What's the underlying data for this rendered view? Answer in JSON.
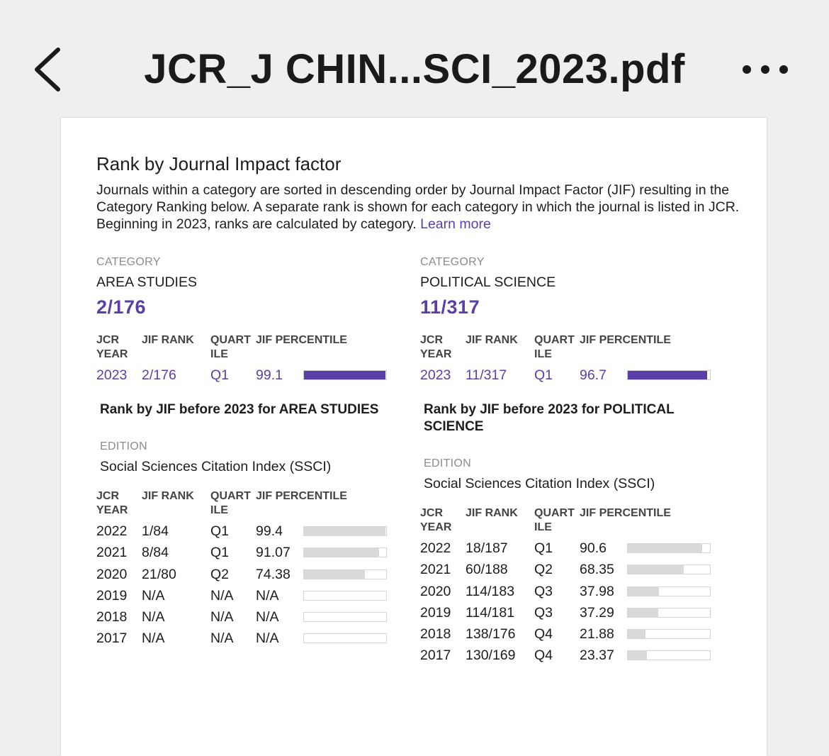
{
  "header": {
    "title": "JCR_J CHIN...SCI_2023.pdf"
  },
  "page": {
    "heading": "Rank by Journal Impact factor",
    "description": "Journals within a category are sorted in descending order by Journal Impact Factor (JIF) resulting in the Category Ranking below. A separate rank is shown for each category in which the journal is listed in JCR. Beginning in 2023, ranks are calculated by category.",
    "learn_more": "Learn more"
  },
  "columns_header": {
    "year": "JCR YEAR",
    "rank": "JIF RANK",
    "quartile": "QUART ILE",
    "percentile": "JIF PERCENTILE"
  },
  "categories": [
    {
      "label": "CATEGORY",
      "name": "AREA STUDIES",
      "rank": "2/176",
      "current": {
        "year": "2023",
        "rank": "2/176",
        "quartile": "Q1",
        "percentile": "99.1",
        "bar": 0.991
      },
      "before_title": "Rank by JIF before 2023 for AREA STUDIES",
      "edition_label": "EDITION",
      "edition": "Social Sciences Citation Index (SSCI)",
      "history": [
        {
          "year": "2022",
          "rank": "1/84",
          "quartile": "Q1",
          "percentile": "99.4",
          "bar": 0.994
        },
        {
          "year": "2021",
          "rank": "8/84",
          "quartile": "Q1",
          "percentile": "91.07",
          "bar": 0.9107
        },
        {
          "year": "2020",
          "rank": "21/80",
          "quartile": "Q2",
          "percentile": "74.38",
          "bar": 0.7438
        },
        {
          "year": "2019",
          "rank": "N/A",
          "quartile": "N/A",
          "percentile": "N/A",
          "bar": 0
        },
        {
          "year": "2018",
          "rank": "N/A",
          "quartile": "N/A",
          "percentile": "N/A",
          "bar": 0
        },
        {
          "year": "2017",
          "rank": "N/A",
          "quartile": "N/A",
          "percentile": "N/A",
          "bar": 0
        }
      ]
    },
    {
      "label": "CATEGORY",
      "name": "POLITICAL SCIENCE",
      "rank": "11/317",
      "current": {
        "year": "2023",
        "rank": "11/317",
        "quartile": "Q1",
        "percentile": "96.7",
        "bar": 0.967
      },
      "before_title": "Rank by JIF before 2023 for POLITICAL SCIENCE",
      "edition_label": "EDITION",
      "edition": "Social Sciences Citation Index (SSCI)",
      "history": [
        {
          "year": "2022",
          "rank": "18/187",
          "quartile": "Q1",
          "percentile": "90.6",
          "bar": 0.906
        },
        {
          "year": "2021",
          "rank": "60/188",
          "quartile": "Q2",
          "percentile": "68.35",
          "bar": 0.6835
        },
        {
          "year": "2020",
          "rank": "114/183",
          "quartile": "Q3",
          "percentile": "37.98",
          "bar": 0.3798
        },
        {
          "year": "2019",
          "rank": "114/181",
          "quartile": "Q3",
          "percentile": "37.29",
          "bar": 0.3729
        },
        {
          "year": "2018",
          "rank": "138/176",
          "quartile": "Q4",
          "percentile": "21.88",
          "bar": 0.2188
        },
        {
          "year": "2017",
          "rank": "130/169",
          "quartile": "Q4",
          "percentile": "23.37",
          "bar": 0.2337
        }
      ]
    }
  ],
  "colors": {
    "accent": "#5b3fa8",
    "bar_grey": "#d9d9d9"
  },
  "icons": {
    "back": "chevron-left-icon",
    "more": "more-horizontal-icon"
  }
}
